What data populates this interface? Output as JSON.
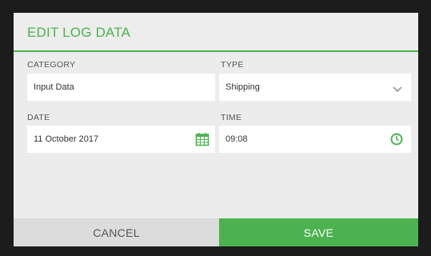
{
  "dialog": {
    "title": "EDIT LOG DATA",
    "category": {
      "label": "CATEGORY",
      "value": "Input Data"
    },
    "type": {
      "label": "TYPE",
      "value": "Shipping"
    },
    "date": {
      "label": "DATE",
      "value": "11 October 2017"
    },
    "time": {
      "label": "TIME",
      "value": "09:08"
    },
    "cancel_label": "CANCEL",
    "save_label": "SAVE"
  },
  "colors": {
    "accent": "#4cb24f",
    "background": "#ececec",
    "field": "#ffffff",
    "cancel": "#dcdcdc"
  },
  "icons": [
    "chevron-down-icon",
    "calendar-icon",
    "clock-icon"
  ]
}
